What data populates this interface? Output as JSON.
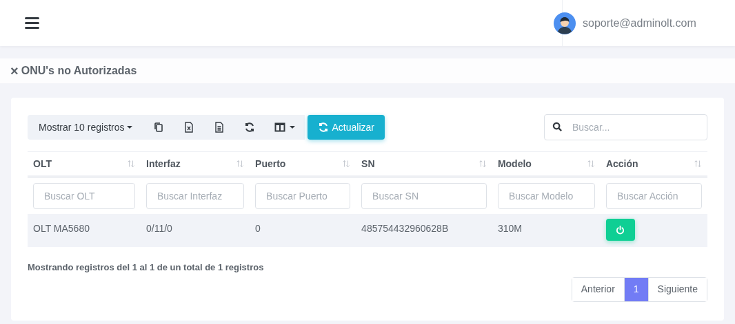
{
  "header": {
    "user": "soporte@adminolt.com"
  },
  "page_title": {
    "icon": "×",
    "text": "ONU's no Autorizadas"
  },
  "toolbar": {
    "length_menu": "Mostrar 10 registros",
    "buttons": [
      {
        "kind": "copy"
      },
      {
        "kind": "excel"
      },
      {
        "kind": "csv"
      },
      {
        "kind": "reload"
      },
      {
        "kind": "columns"
      }
    ],
    "refresh": "Actualizar"
  },
  "search": {
    "placeholder": "Buscar..."
  },
  "table": {
    "columns": [
      {
        "label": "OLT",
        "placeholder": "Buscar OLT"
      },
      {
        "label": "Interfaz",
        "placeholder": "Buscar Interfaz"
      },
      {
        "label": "Puerto",
        "placeholder": "Buscar Puerto"
      },
      {
        "label": "SN",
        "placeholder": "Buscar SN"
      },
      {
        "label": "Modelo",
        "placeholder": "Buscar Modelo"
      },
      {
        "label": "Acción",
        "placeholder": "Buscar Acción"
      }
    ],
    "rows": [
      {
        "cells": [
          "OLT MA5680",
          "0/11/0",
          "0",
          "485754432960628B",
          "310M"
        ]
      }
    ]
  },
  "info": "Mostrando registros del 1 al 1 de un total de 1 registros",
  "pagination": [
    {
      "label": "Anterior",
      "selected": false
    },
    {
      "label": "1",
      "selected": true
    },
    {
      "label": "Siguiente",
      "selected": false
    }
  ]
}
